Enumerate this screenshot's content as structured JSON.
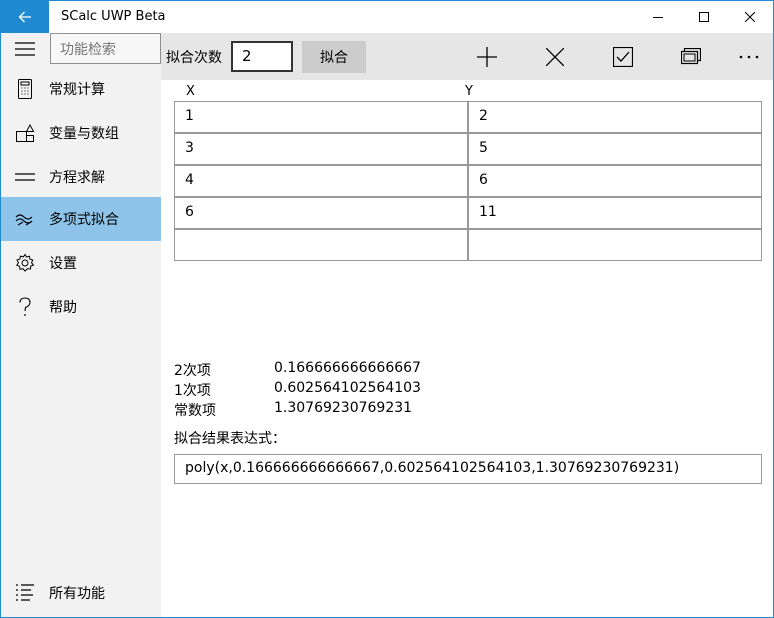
{
  "titlebar": {
    "title": "SCalc UWP Beta"
  },
  "sidebar": {
    "search_placeholder": "功能检索",
    "items": [
      {
        "label": "常规计算",
        "icon": "calculator-icon"
      },
      {
        "label": "变量与数组",
        "icon": "shapes-icon"
      },
      {
        "label": "方程求解",
        "icon": "equals-icon"
      },
      {
        "label": "多项式拟合",
        "icon": "wave-icon",
        "active": true
      },
      {
        "label": "设置",
        "icon": "gear-icon"
      },
      {
        "label": "帮助",
        "icon": "question-icon"
      }
    ],
    "all_functions": "所有功能"
  },
  "toolbar": {
    "degree_label": "拟合次数",
    "degree_value": "2",
    "fit_label": "拟合"
  },
  "table": {
    "headers": [
      "X",
      "Y"
    ],
    "rows": [
      [
        "1",
        "2"
      ],
      [
        "3",
        "5"
      ],
      [
        "4",
        "6"
      ],
      [
        "6",
        "11"
      ],
      [
        "",
        ""
      ]
    ]
  },
  "results": {
    "terms": [
      {
        "label": "2次项",
        "value": "0.166666666666667"
      },
      {
        "label": "1次项",
        "value": "0.602564102564103"
      },
      {
        "label": "常数项",
        "value": "1.30769230769231"
      }
    ],
    "expr_label": "拟合结果表达式：",
    "expr_value": "poly(x,0.166666666666667,0.602564102564103,1.30769230769231)"
  },
  "colors": {
    "accent": "#1f8ad2",
    "active_nav": "#8ec3ea",
    "toolbar_bg": "#e6e6e6",
    "sidebar_bg": "#f2f2f2"
  }
}
